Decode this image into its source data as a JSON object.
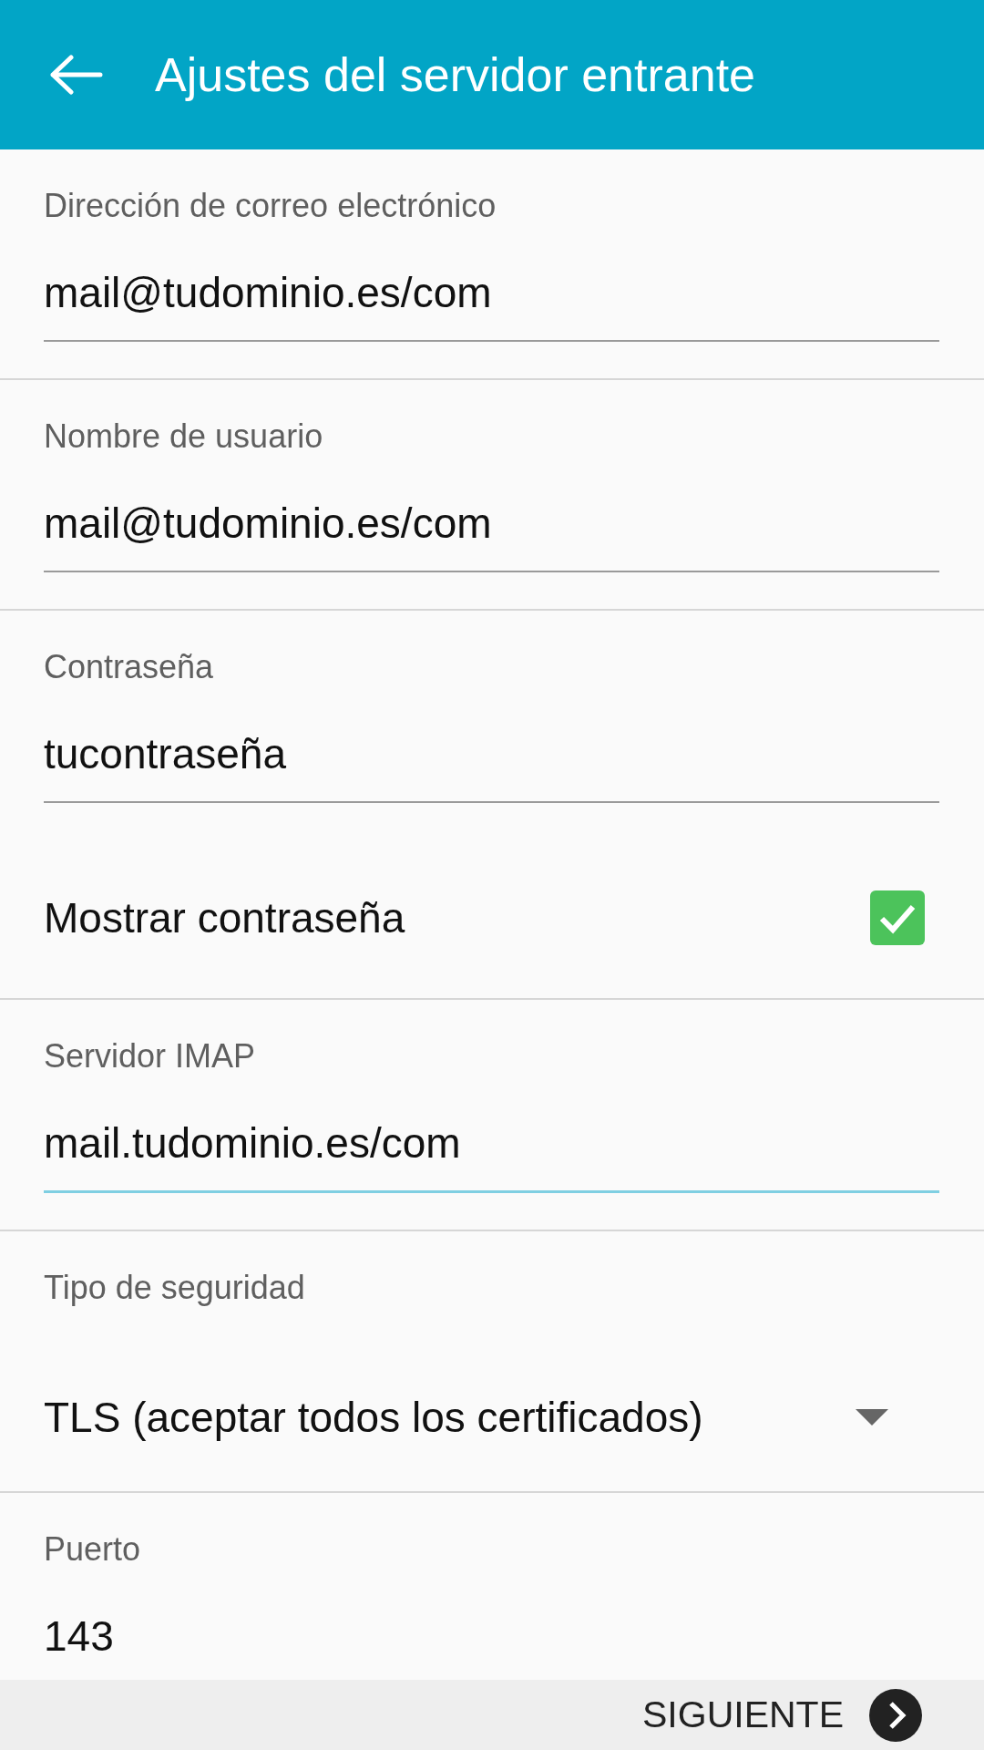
{
  "app_bar": {
    "title": "Ajustes del servidor entrante"
  },
  "fields": [
    {
      "kind": "text",
      "label": "Dirección de correo electrónico",
      "value": "mail@tudominio.es/com",
      "focused": false
    },
    {
      "kind": "text",
      "label": "Nombre de usuario",
      "value": "mail@tudominio.es/com",
      "focused": false
    },
    {
      "kind": "password",
      "label": "Contraseña",
      "value": "tucontraseña",
      "focused": false
    },
    {
      "kind": "checkbox",
      "label": "Mostrar contraseña",
      "checked": true
    },
    {
      "kind": "text",
      "label": "Servidor IMAP",
      "value": "mail.tudominio.es/com",
      "focused": true
    },
    {
      "kind": "dropdown",
      "label": "Tipo de seguridad",
      "value": "TLS (aceptar todos los certificados)"
    },
    {
      "kind": "text",
      "label": "Puerto",
      "value": "143",
      "focused": false
    }
  ],
  "footer": {
    "next_button": "SIGUIENTE"
  }
}
